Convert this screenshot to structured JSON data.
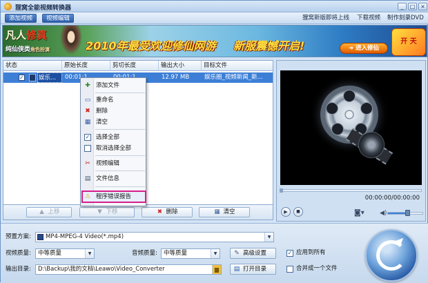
{
  "window": {
    "title": "狸窝全能视频转换器"
  },
  "title_buttons": [
    "_",
    "□",
    "×"
  ],
  "menu": {
    "tabs": [
      "添加视频",
      "视频编辑"
    ],
    "links": [
      "狸窝新版即将上线",
      "下载视频",
      "制作刻录DVD"
    ]
  },
  "banner": {
    "brand_a": "凡人",
    "brand_b": "修真",
    "tagline": "纯仙侠类",
    "tagline_small": "角色扮演",
    "slogan_a": "2010年最受欢迎修仙网游",
    "slogan_b": "新服震憾开启!",
    "go_button": "进入修仙",
    "badge": "开 天"
  },
  "file_list": {
    "columns": [
      "状态",
      "原始长度",
      "剪切长度",
      "输出大小",
      "目标文件"
    ],
    "rows": [
      {
        "checked": true,
        "name": "娱乐...",
        "original_length": "00:01:1",
        "cut_length": "00:01:1",
        "output_size": "12.97 MB",
        "target": "娱乐圈_视频新闻_新..."
      }
    ],
    "buttons": {
      "up": "上移",
      "down": "下移",
      "delete": "删除",
      "clear": "清空"
    }
  },
  "context_menu": {
    "items": [
      {
        "label": "添加文件",
        "icon": "add-file-icon"
      },
      {
        "label": "重命名",
        "icon": "rename-icon"
      },
      {
        "label": "删除",
        "icon": "delete-icon"
      },
      {
        "label": "清空",
        "icon": "clear-icon"
      },
      {
        "label": "选择全部",
        "icon": "checkbox-checked-icon"
      },
      {
        "label": "取消选择全部",
        "icon": "checkbox-empty-icon"
      },
      {
        "label": "视频编辑",
        "icon": "scissors-icon"
      },
      {
        "label": "文件信息",
        "icon": "document-icon"
      },
      {
        "label": "程序错误报告",
        "icon": "warning-icon"
      }
    ]
  },
  "preview": {
    "time": "00:00:00/00:00:00",
    "volume_level": 0.55
  },
  "settings": {
    "preset_label": "预置方案:",
    "preset_value": "MP4-MPEG-4 Video(*.mp4)",
    "video_quality_label": "视频质量:",
    "video_quality_value": "中等质量",
    "audio_quality_label": "音频质量:",
    "audio_quality_value": "中等质量",
    "advanced_button": "高级设置",
    "apply_all_label": "应用到所有",
    "apply_all_checked": true,
    "output_label": "输出目录:",
    "output_path": "D:\\Backup\\我的文档\\Leawo\\Video_Converter",
    "open_dir_button": "打开目录",
    "merge_label": "合并成一个文件",
    "merge_checked": false
  },
  "colors": {
    "selection": "#3d7fd6",
    "highlight_border": "#d61c8c",
    "accent": "#2c5ea8"
  }
}
